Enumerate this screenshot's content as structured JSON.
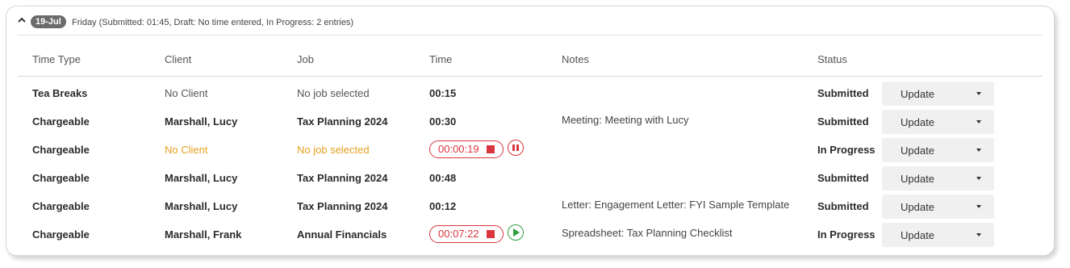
{
  "day": {
    "date_label": "19-Jul",
    "summary": "Friday (Submitted: 01:45, Draft: No time entered, In Progress: 2 entries)"
  },
  "columns": {
    "time_type": "Time Type",
    "client": "Client",
    "job": "Job",
    "time": "Time",
    "notes": "Notes",
    "status": "Status"
  },
  "rows": [
    {
      "time_type": "Tea Breaks",
      "client": "No Client",
      "job": "No job selected",
      "time": "00:15",
      "notes": "",
      "status": "Submitted",
      "action": "Update"
    },
    {
      "time_type": "Chargeable",
      "client": "Marshall, Lucy",
      "job": "Tax Planning 2024",
      "time": "00:30",
      "notes": "Meeting: Meeting with Lucy",
      "status": "Submitted",
      "action": "Update"
    },
    {
      "time_type": "Chargeable",
      "client": "No Client",
      "job": "No job selected",
      "timer": "00:00:19",
      "timer_state": "running",
      "notes": "",
      "status": "In Progress",
      "action": "Update"
    },
    {
      "time_type": "Chargeable",
      "client": "Marshall, Lucy",
      "job": "Tax Planning 2024",
      "time": "00:48",
      "notes": "",
      "status": "Submitted",
      "action": "Update"
    },
    {
      "time_type": "Chargeable",
      "client": "Marshall, Lucy",
      "job": "Tax Planning 2024",
      "time": "00:12",
      "notes": "Letter: Engagement Letter: FYI Sample Template",
      "status": "Submitted",
      "action": "Update"
    },
    {
      "time_type": "Chargeable",
      "client": "Marshall, Frank",
      "job": "Annual Financials",
      "timer": "00:07:22",
      "timer_state": "paused",
      "notes": "Spreadsheet: Tax Planning Checklist",
      "status": "In Progress",
      "action": "Update"
    }
  ],
  "colors": {
    "warning_text": "#e6a020",
    "timer_red": "#d9363e",
    "play_green": "#2e9e3e",
    "date_pill": "#6b6b6b"
  },
  "icons": {
    "collapse": "chevron-up-icon",
    "stop": "stop-icon",
    "pause": "pause-icon",
    "play": "play-icon",
    "dropdown": "caret-down-icon"
  }
}
